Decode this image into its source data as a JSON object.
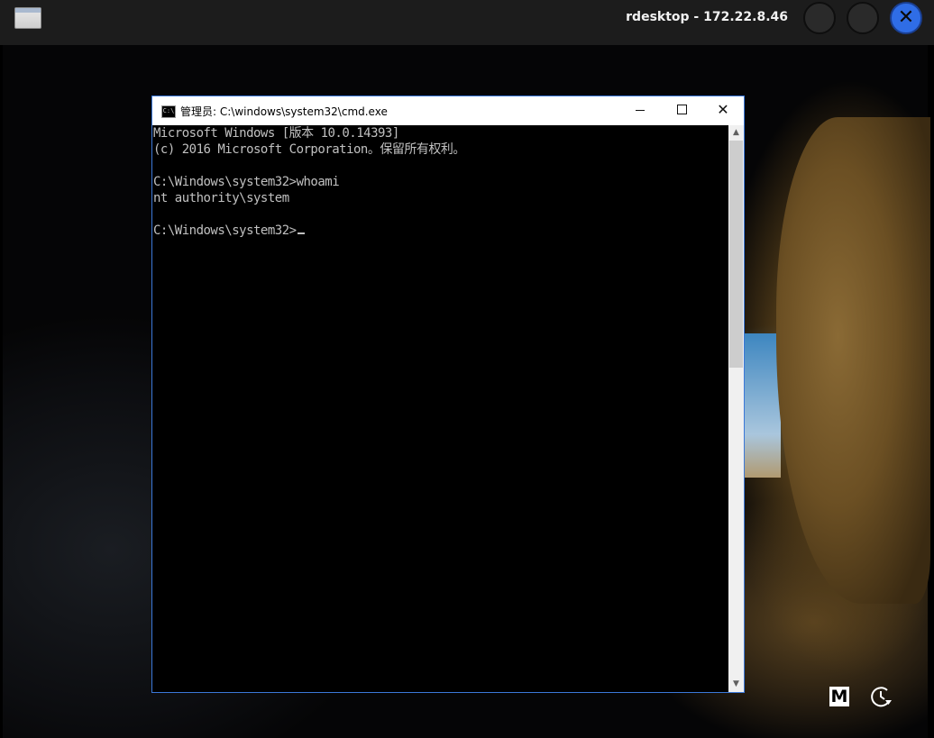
{
  "rdesktop": {
    "title": "rdesktop - 172.22.8.46",
    "close_glyph": "✕"
  },
  "cmd": {
    "title": "管理员: C:\\windows\\system32\\cmd.exe",
    "icon_label": "C:\\",
    "lines": [
      "Microsoft Windows [版本 10.0.14393]",
      "(c) 2016 Microsoft Corporation。保留所有权利。",
      "",
      "C:\\Windows\\system32>whoami",
      "nt authority\\system",
      "",
      "C:\\Windows\\system32>"
    ],
    "controls": {
      "close_glyph": "✕"
    },
    "scroll_up_glyph": "▲",
    "scroll_down_glyph": "▼"
  },
  "tray": {
    "m_icon_label": "M"
  }
}
